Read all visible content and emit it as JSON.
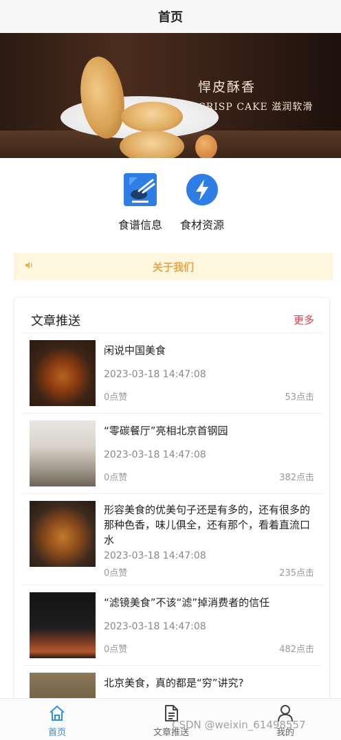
{
  "header": {
    "title": "首页"
  },
  "banner": {
    "slogan_line1": "悍皮酥香",
    "slogan_line2": "CRISP CAKE 滋润软滑",
    "slide_count": 3,
    "active_slide": 2
  },
  "quick_links": [
    {
      "label": "食谱信息",
      "icon": "recipe-icon"
    },
    {
      "label": "食材资源",
      "icon": "lightning-icon"
    }
  ],
  "notice": {
    "label": "关于我们",
    "icon": "speaker-icon"
  },
  "articles": {
    "title": "文章推送",
    "more_label": "更多",
    "items": [
      {
        "title": "闲说中国美食",
        "date": "2023-03-18 14:47:08",
        "likes": "0点赞",
        "clicks": "53点击"
      },
      {
        "title": "“零碳餐厅”亮相北京首钢园",
        "date": "2023-03-18 14:47:08",
        "likes": "0点赞",
        "clicks": "382点击"
      },
      {
        "title": "形容美食的优美句子还是有多的，还有很多的那种色香，味儿俱全，还有那个，看着直流口水",
        "date": "2023-03-18 14:47:08",
        "likes": "0点赞",
        "clicks": "235点击"
      },
      {
        "title": "“滤镜美食”不该“滤”掉消费者的信任",
        "date": "2023-03-18 14:47:08",
        "likes": "0点赞",
        "clicks": "482点击"
      },
      {
        "title": "北京美食，真的都是“穷”讲究?"
      }
    ]
  },
  "tabbar": {
    "items": [
      {
        "label": "首页",
        "icon": "home-icon",
        "active": true
      },
      {
        "label": "文章推送",
        "icon": "document-icon",
        "active": false
      },
      {
        "label": "我的",
        "icon": "user-icon",
        "active": false
      }
    ]
  },
  "watermark": "CSDN @weixin_61498557",
  "colors": {
    "accent": "#2f8de4",
    "more": "#e03e4f",
    "notice_bg": "#fff6de",
    "notice_text": "#e3a64e"
  }
}
